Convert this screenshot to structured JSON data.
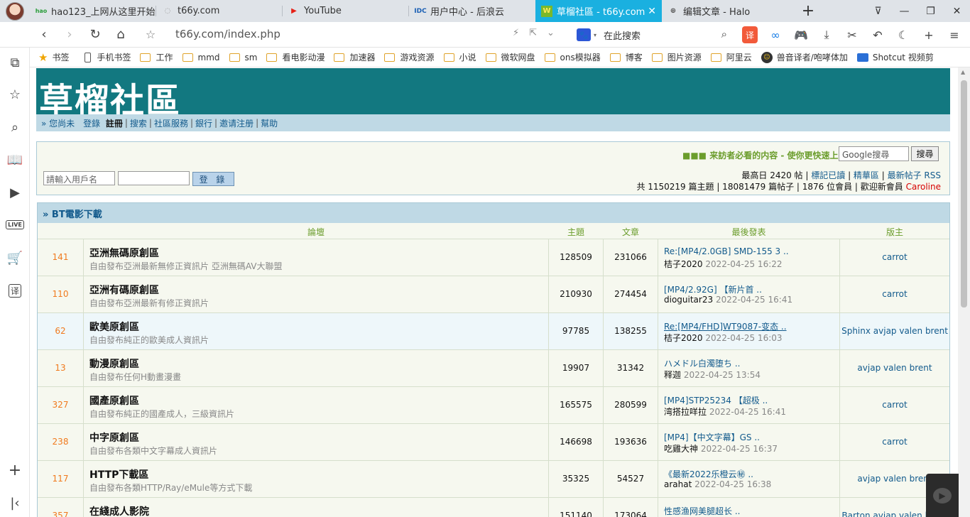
{
  "tabs": [
    {
      "title": "hao123_上网从这里开始",
      "icon": "hao"
    },
    {
      "title": "t66y.com",
      "icon": "loading"
    },
    {
      "title": "YouTube",
      "icon": "youtube"
    },
    {
      "title": "用户中心 - 后浪云",
      "icon": "IDC"
    },
    {
      "title": "草榴社區 - t66y.com",
      "icon": "leaf",
      "active": true
    },
    {
      "title": "编辑文章 - Halo",
      "icon": "globe"
    }
  ],
  "address": {
    "url": "t66y.com/index.php",
    "search_placeholder": "在此搜索"
  },
  "toolbar": {
    "translate": "译"
  },
  "bookmarks": [
    "书签",
    "手机书签",
    "工作",
    "mmd",
    "sm",
    "看电影动漫",
    "加速器",
    "游戏资源",
    "小说",
    "微软网盘",
    "ons模拟器",
    "博客",
    "图片资源",
    "阿里云",
    "兽音译者/咆哮体加",
    "Shotcut 视频剪"
  ],
  "bookmark_icons": [
    "star",
    "phone",
    "folder",
    "folder",
    "folder",
    "folder",
    "folder",
    "folder",
    "folder",
    "folder",
    "folder",
    "folder",
    "folder",
    "folder",
    "avatar",
    "shotcut"
  ],
  "site": {
    "logo": "草榴社區",
    "subnav": [
      {
        "text": "» 您尚未　"
      },
      {
        "text": "登錄",
        "link": true
      },
      {
        "text": "  "
      },
      {
        "text": "註冊",
        "bold": true
      },
      {
        "sep": "|"
      },
      {
        "text": "搜索",
        "link": true
      },
      {
        "sep": "|"
      },
      {
        "text": "社區服務",
        "link": true
      },
      {
        "sep": "|"
      },
      {
        "text": "銀行",
        "link": true
      },
      {
        "sep": "|"
      },
      {
        "text": "邀请注册",
        "link": true
      },
      {
        "sep": "|"
      },
      {
        "text": "幫助",
        "link": true
      }
    ],
    "notice": "■■■ 来訪者必看的内容 - 使你更快速上",
    "google_search": "Google搜尋",
    "search_button": "搜尋",
    "username_placeholder": "請輸入用戶名",
    "login_button": "登 錄",
    "stats_line1": {
      "max": "最高日 2420 帖",
      "links": [
        "標記已讀",
        "精華區",
        "最新帖子 RSS"
      ]
    },
    "stats_line2": {
      "text": "共 1150219 篇主題 | 18081479 篇帖子 | 1876 位會員 | 歡迎新會員 ",
      "new_member": "Caroline"
    }
  },
  "forum": {
    "section": "» BT電影下載",
    "columns": {
      "forum": "論壇",
      "topics": "主題",
      "posts": "文章",
      "last": "最後發表",
      "mod": "版主"
    },
    "rows": [
      {
        "today": "141",
        "title": "亞洲無碼原創區",
        "desc": "自由發布亞洲最新無修正資訊片 亞洲無碼AV大聯盟",
        "topics": "128509",
        "posts": "231066",
        "last_title": "Re:[MP4/2.0GB] SMD-155 3 ..",
        "last_user": "桔子2020",
        "last_time": "2022-04-25 16:22",
        "mod": "carrot"
      },
      {
        "today": "110",
        "title": "亞洲有碼原創區",
        "desc": "自由發布亞洲最新有修正資訊片",
        "topics": "210930",
        "posts": "274454",
        "last_title": "[MP4/2.92G] 【新片首 ..",
        "last_user": "dioguitar23",
        "last_time": "2022-04-25 16:41",
        "mod": "carrot"
      },
      {
        "today": "62",
        "title": "歐美原創區",
        "desc": "自由發布純正的歐美成人資訊片",
        "topics": "97785",
        "posts": "138255",
        "last_title": "Re:[MP4/FHD]WT9087-变态 ..",
        "last_user": "桔子2020",
        "last_time": "2022-04-25 16:03",
        "mod": "Sphinx avjap valen brent",
        "highlight": true
      },
      {
        "today": "13",
        "title": "動漫原創區",
        "desc": "自由發布任何H動畫漫畫",
        "topics": "19907",
        "posts": "31342",
        "last_title": "ハメドル白濁堕ち ..",
        "last_user": "释迦",
        "last_time": "2022-04-25 13:54",
        "mod": "avjap valen brent"
      },
      {
        "today": "327",
        "title": "國產原創區",
        "desc": "自由發布純正的國產成人，三級資訊片",
        "topics": "165575",
        "posts": "280599",
        "last_title": "[MP4]STP25234 【超极 ..",
        "last_user": "湾搭拉咩拉",
        "last_time": "2022-04-25 16:41",
        "mod": "carrot"
      },
      {
        "today": "238",
        "title": "中字原創區",
        "desc": "自由發布各類中文字幕成人資訊片",
        "topics": "146698",
        "posts": "193636",
        "last_title": "[MP4]【中文字幕】GS ..",
        "last_user": "吃雞大神",
        "last_time": "2022-04-25 16:37",
        "mod": "carrot"
      },
      {
        "today": "117",
        "title": "HTTP下載區",
        "desc": "自由發布各類HTTP/Ray/eMule等方式下載",
        "topics": "35325",
        "posts": "54527",
        "last_title": "《最新2022乐橙云㊙ ..",
        "last_user": "arahat",
        "last_time": "2022-04-25 16:38",
        "mod": "avjap valen brent"
      },
      {
        "today": "357",
        "title": "在綫成人影院",
        "desc": "",
        "topics": "151140",
        "posts": "173064",
        "last_title": "性感渔网美腿超长 ..",
        "last_user": "",
        "last_time": "",
        "mod": "Barton avjap valen brent"
      }
    ]
  }
}
